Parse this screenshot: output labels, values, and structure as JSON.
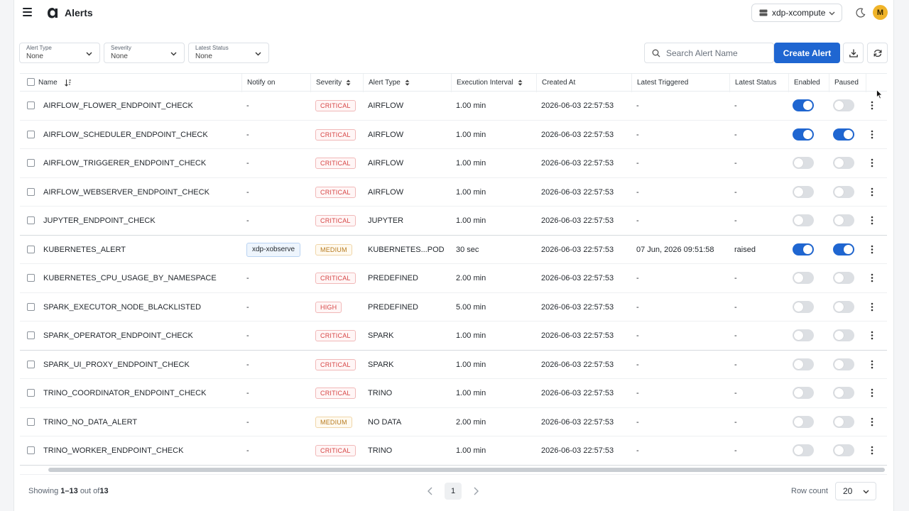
{
  "header": {
    "title": "Alerts",
    "workspace": "xdp-xcompute",
    "avatar_initial": "M"
  },
  "filters": [
    {
      "label": "Alert Type",
      "value": "None"
    },
    {
      "label": "Severity",
      "value": "None"
    },
    {
      "label": "Latest Status",
      "value": "None"
    }
  ],
  "search": {
    "placeholder": "Search Alert Name"
  },
  "actions": {
    "create_label": "Create Alert"
  },
  "columns": {
    "name": "Name",
    "notify_on": "Notify on",
    "severity": "Severity",
    "alert_type": "Alert Type",
    "execution_interval": "Execution Interval",
    "created_at": "Created At",
    "latest_triggered": "Latest Triggered",
    "latest_status": "Latest Status",
    "enabled": "Enabled",
    "paused": "Paused"
  },
  "rows": [
    {
      "name": "AIRFLOW_FLOWER_ENDPOINT_CHECK",
      "notify": "-",
      "severity": "CRITICAL",
      "type": "AIRFLOW",
      "interval": "1.00 min",
      "created": "2026-06-03 22:57:53",
      "triggered": "-",
      "status": "-",
      "enabled": true,
      "paused": false
    },
    {
      "name": "AIRFLOW_SCHEDULER_ENDPOINT_CHECK",
      "notify": "-",
      "severity": "CRITICAL",
      "type": "AIRFLOW",
      "interval": "1.00 min",
      "created": "2026-06-03 22:57:53",
      "triggered": "-",
      "status": "-",
      "enabled": true,
      "paused": true
    },
    {
      "name": "AIRFLOW_TRIGGERER_ENDPOINT_CHECK",
      "notify": "-",
      "severity": "CRITICAL",
      "type": "AIRFLOW",
      "interval": "1.00 min",
      "created": "2026-06-03 22:57:53",
      "triggered": "-",
      "status": "-",
      "enabled": false,
      "paused": false
    },
    {
      "name": "AIRFLOW_WEBSERVER_ENDPOINT_CHECK",
      "notify": "-",
      "severity": "CRITICAL",
      "type": "AIRFLOW",
      "interval": "1.00 min",
      "created": "2026-06-03 22:57:53",
      "triggered": "-",
      "status": "-",
      "enabled": false,
      "paused": false
    },
    {
      "name": "JUPYTER_ENDPOINT_CHECK",
      "notify": "-",
      "severity": "CRITICAL",
      "type": "JUPYTER",
      "interval": "1.00 min",
      "created": "2026-06-03 22:57:53",
      "triggered": "-",
      "status": "-",
      "enabled": false,
      "paused": false
    },
    {
      "name": "KUBERNETES_ALERT",
      "notify": "xdp-xobserve",
      "severity": "MEDIUM",
      "type": "KUBERNETES...POD",
      "interval": "30 sec",
      "created": "2026-06-03 22:57:53",
      "triggered": "07 Jun, 2026 09:51:58",
      "status": "raised",
      "enabled": true,
      "paused": true
    },
    {
      "name": "KUBERNETES_CPU_USAGE_BY_NAMESPACE",
      "notify": "-",
      "severity": "CRITICAL",
      "type": "PREDEFINED",
      "interval": "2.00 min",
      "created": "2026-06-03 22:57:53",
      "triggered": "-",
      "status": "-",
      "enabled": false,
      "paused": false
    },
    {
      "name": "SPARK_EXECUTOR_NODE_BLACKLISTED",
      "notify": "-",
      "severity": "HIGH",
      "type": "PREDEFINED",
      "interval": "5.00 min",
      "created": "2026-06-03 22:57:53",
      "triggered": "-",
      "status": "-",
      "enabled": false,
      "paused": false
    },
    {
      "name": "SPARK_OPERATOR_ENDPOINT_CHECK",
      "notify": "-",
      "severity": "CRITICAL",
      "type": "SPARK",
      "interval": "1.00 min",
      "created": "2026-06-03 22:57:53",
      "triggered": "-",
      "status": "-",
      "enabled": false,
      "paused": false
    },
    {
      "name": "SPARK_UI_PROXY_ENDPOINT_CHECK",
      "notify": "-",
      "severity": "CRITICAL",
      "type": "SPARK",
      "interval": "1.00 min",
      "created": "2026-06-03 22:57:53",
      "triggered": "-",
      "status": "-",
      "enabled": false,
      "paused": false
    },
    {
      "name": "TRINO_COORDINATOR_ENDPOINT_CHECK",
      "notify": "-",
      "severity": "CRITICAL",
      "type": "TRINO",
      "interval": "1.00 min",
      "created": "2026-06-03 22:57:53",
      "triggered": "-",
      "status": "-",
      "enabled": false,
      "paused": false
    },
    {
      "name": "TRINO_NO_DATA_ALERT",
      "notify": "-",
      "severity": "MEDIUM",
      "type": "NO DATA",
      "interval": "2.00 min",
      "created": "2026-06-03 22:57:53",
      "triggered": "-",
      "status": "-",
      "enabled": false,
      "paused": false
    },
    {
      "name": "TRINO_WORKER_ENDPOINT_CHECK",
      "notify": "-",
      "severity": "CRITICAL",
      "type": "TRINO",
      "interval": "1.00 min",
      "created": "2026-06-03 22:57:53",
      "triggered": "-",
      "status": "-",
      "enabled": false,
      "paused": false
    }
  ],
  "footer": {
    "showing_prefix": "Showing",
    "range": "1–13",
    "out_of": "out of",
    "total": "13",
    "current_page": "1",
    "row_count_label": "Row count",
    "row_count": "20"
  },
  "colors": {
    "accent": "#1f66d1",
    "critical": "#d64545",
    "medium": "#b6791d"
  }
}
